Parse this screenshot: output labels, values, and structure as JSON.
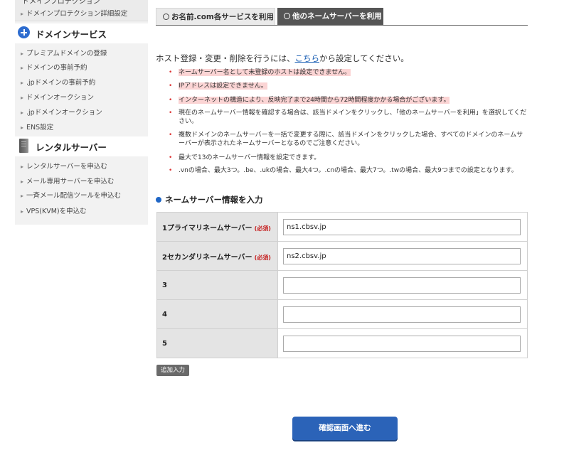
{
  "sidebar": {
    "top_partial_label": "ドメインプロテクション",
    "top_link": "ドメインプロテクション詳細設定",
    "domain_section": {
      "title": "ドメインサービス",
      "icon": "plus-circle-icon",
      "items": [
        "プレミアムドメインの登録",
        "ドメインの事前予約",
        ".jpドメインの事前予約",
        "ドメインオークション",
        ".jpドメインオークション",
        "ENS設定"
      ]
    },
    "server_section": {
      "title": "レンタルサーバー",
      "icon": "server-icon",
      "items": [
        "レンタルサーバーを申込む",
        "メール専用サーバーを申込む",
        "一斉メール配信ツールを申込む",
        "VPS(KVM)を申込む"
      ]
    }
  },
  "tabs": [
    {
      "label": "お名前.com各サービスを利用",
      "selected": false
    },
    {
      "label": "他のネームサーバーを利用",
      "selected": true
    }
  ],
  "intro": {
    "before": "ホスト登録・変更・削除を行うには、",
    "link": "こちら",
    "after": "から設定してください。"
  },
  "notes": [
    {
      "text": "ネームサーバー名として未登録のホストは設定できません。",
      "highlight": true
    },
    {
      "text": "IPアドレスは設定できません。",
      "highlight": true
    },
    {
      "text": "インターネットの構造により、反映完了まで24時間から72時間程度かかる場合がございます。",
      "highlight": true
    },
    {
      "text": "現在のネームサーバー情報を確認する場合は、該当ドメインをクリックし、「他のネームサーバーを利用」を選択してください。",
      "highlight": false
    },
    {
      "text": "複数ドメインのネームサーバーを一括で変更する際に、該当ドメインをクリックした場合、すべてのドメインのネームサーバーが表示されたネームサーバーとなるのでご注意ください。",
      "highlight": false
    },
    {
      "text": "最大で13のネームサーバー情報を設定できます。",
      "highlight": false
    },
    {
      "text": ".vnの場合、最大3つ。.be、.ukの場合、最大4つ。.cnの場合、最大7つ。.twの場合、最大9つまでの設定となります。",
      "highlight": false
    }
  ],
  "section_title": "ネームサーバー情報を入力",
  "required_label": "(必須)",
  "nameservers": [
    {
      "label": "1プライマリネームサーバー",
      "required": true,
      "value": "ns1.cbsv.jp"
    },
    {
      "label": "2セカンダリネームサーバー",
      "required": true,
      "value": "ns2.cbsv.jp"
    },
    {
      "label": "3",
      "required": false,
      "value": ""
    },
    {
      "label": "4",
      "required": false,
      "value": ""
    },
    {
      "label": "5",
      "required": false,
      "value": ""
    }
  ],
  "add_button": "追加入力",
  "confirm_button": "確認画面へ進む",
  "colors": {
    "accent_blue": "#2b63b8",
    "tab_active": "#555555",
    "highlight": "#fbd4d4",
    "required": "#c62020"
  }
}
